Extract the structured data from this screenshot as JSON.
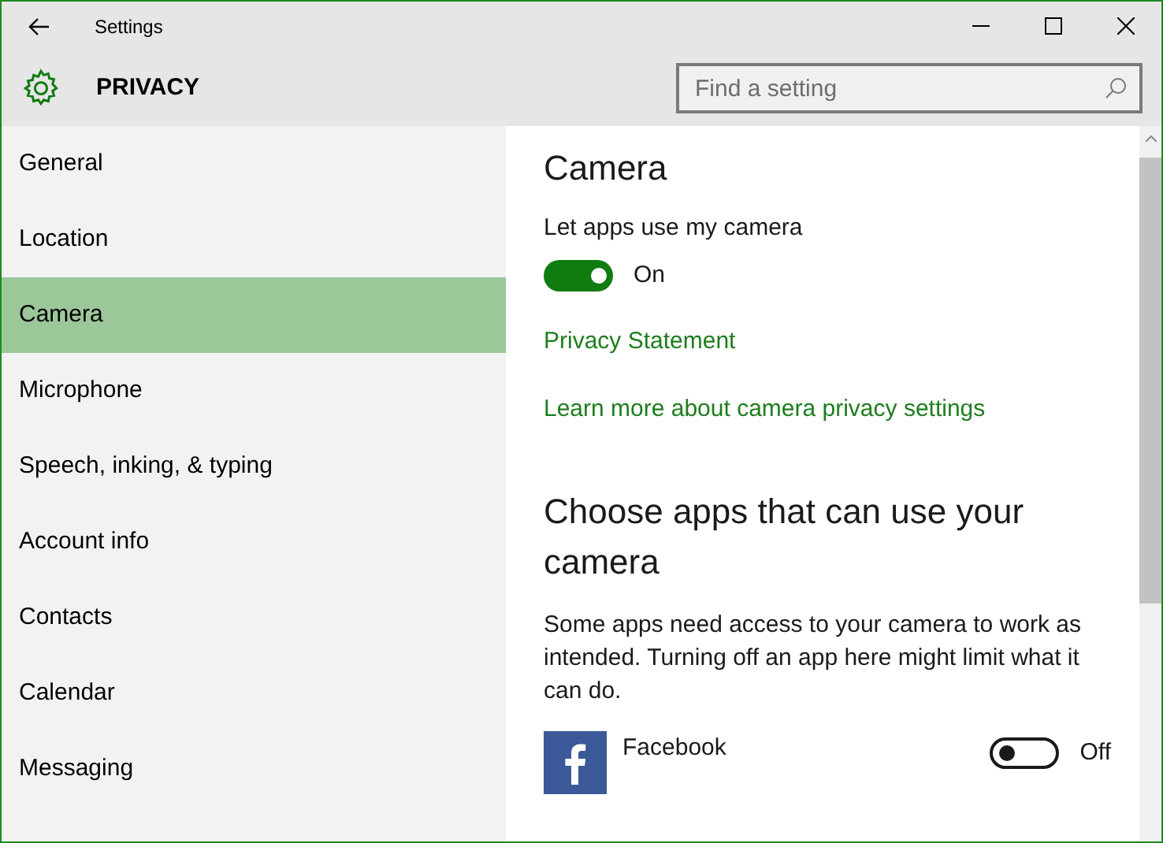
{
  "window": {
    "title": "Settings"
  },
  "header": {
    "title": "PRIVACY",
    "search": {
      "placeholder": "Find a setting"
    }
  },
  "sidebar": {
    "items": [
      {
        "label": "General",
        "selected": false
      },
      {
        "label": "Location",
        "selected": false
      },
      {
        "label": "Camera",
        "selected": true
      },
      {
        "label": "Microphone",
        "selected": false
      },
      {
        "label": "Speech, inking, & typing",
        "selected": false
      },
      {
        "label": "Account info",
        "selected": false
      },
      {
        "label": "Contacts",
        "selected": false
      },
      {
        "label": "Calendar",
        "selected": false
      },
      {
        "label": "Messaging",
        "selected": false
      }
    ]
  },
  "content": {
    "title": "Camera",
    "setting_label": "Let apps use my camera",
    "toggle": {
      "on": true,
      "label": "On"
    },
    "links": [
      "Privacy Statement",
      "Learn more about camera privacy settings"
    ],
    "apps_heading": "Choose apps that can use your camera",
    "apps_description": "Some apps need access to your camera to work as intended. Turning off an app here might limit what it can do.",
    "apps": [
      {
        "name": "Facebook",
        "kind": "facebook",
        "on": false,
        "toggle_label": "Off"
      }
    ]
  }
}
